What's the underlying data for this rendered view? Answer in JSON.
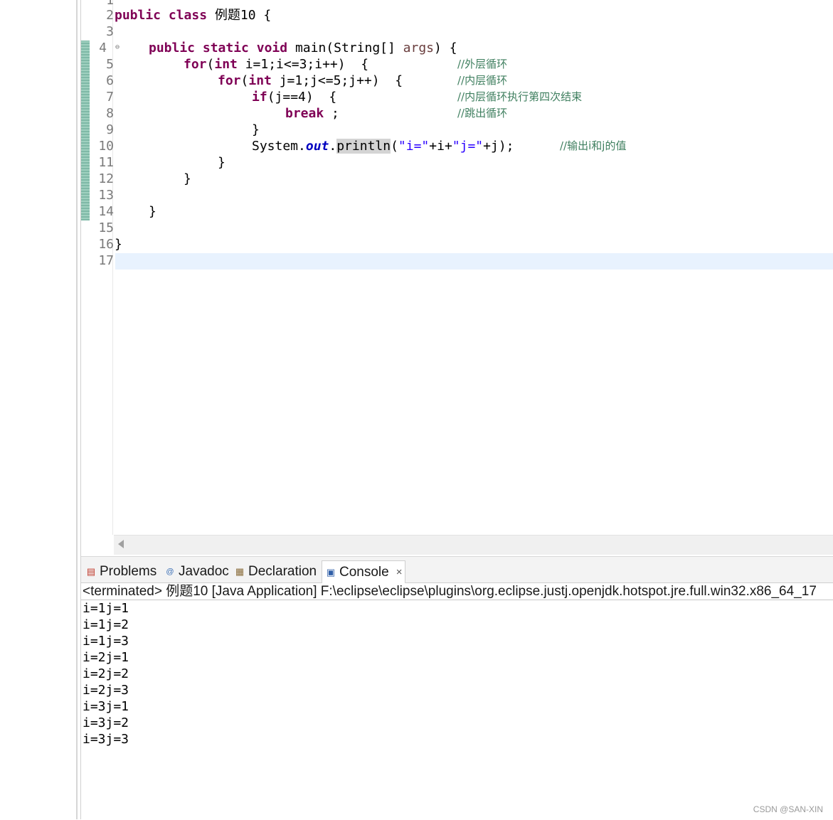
{
  "editor": {
    "line_numbers": [
      "1",
      "2",
      "3",
      "4",
      "5",
      "6",
      "7",
      "8",
      "9",
      "10",
      "11",
      "12",
      "13",
      "14",
      "15",
      "16",
      "17"
    ],
    "code": {
      "l2": {
        "kw1": "public",
        "kw2": "class",
        "name": "例题10 {"
      },
      "l4": {
        "kw1": "public",
        "kw2": "static",
        "kw3": "void",
        "rest1": " main(String[] ",
        "param": "args",
        "rest2": ") {"
      },
      "l5": {
        "kw1": "for",
        "p1": "(",
        "kw2": "int",
        "rest": " i=1;i<=3;i++)  {",
        "comment": "//外层循环"
      },
      "l6": {
        "kw1": "for",
        "p1": "(",
        "kw2": "int",
        "rest": " j=1;j<=5;j++)  {",
        "comment": "//内层循环"
      },
      "l7": {
        "kw1": "if",
        "rest": "(j==4)  {",
        "comment": "//内层循环执行第四次结束"
      },
      "l8": {
        "kw1": "break",
        "rest": " ;",
        "comment": "//跳出循环"
      },
      "l9": {
        "text": "}"
      },
      "l10": {
        "pre": "System.",
        "field": "out",
        "dot": ".",
        "method": "println",
        "open": "(",
        "s1": "\"i=\"",
        "plus1": "+i+",
        "s2": "\"j=\"",
        "tail": "+j);",
        "comment": "//输出i和j的值"
      },
      "l11": {
        "text": "}"
      },
      "l12": {
        "text": "}"
      },
      "l14": {
        "text": "}"
      },
      "l16": {
        "text": "}"
      }
    }
  },
  "panel": {
    "tabs": [
      {
        "label": "Problems",
        "icon": "problems-icon"
      },
      {
        "label": "Javadoc",
        "icon": "javadoc-icon"
      },
      {
        "label": "Declaration",
        "icon": "declaration-icon"
      },
      {
        "label": "Console",
        "icon": "console-icon",
        "close": "×"
      }
    ],
    "console_header": "<terminated> 例题10 [Java Application] F:\\eclipse\\eclipse\\plugins\\org.eclipse.justj.openjdk.hotspot.jre.full.win32.x86_64_17",
    "output": [
      "i=1j=1",
      "i=1j=2",
      "i=1j=3",
      "i=2j=1",
      "i=2j=2",
      "i=2j=3",
      "i=3j=1",
      "i=3j=2",
      "i=3j=3"
    ]
  },
  "watermark": "CSDN @SAN-XIN"
}
